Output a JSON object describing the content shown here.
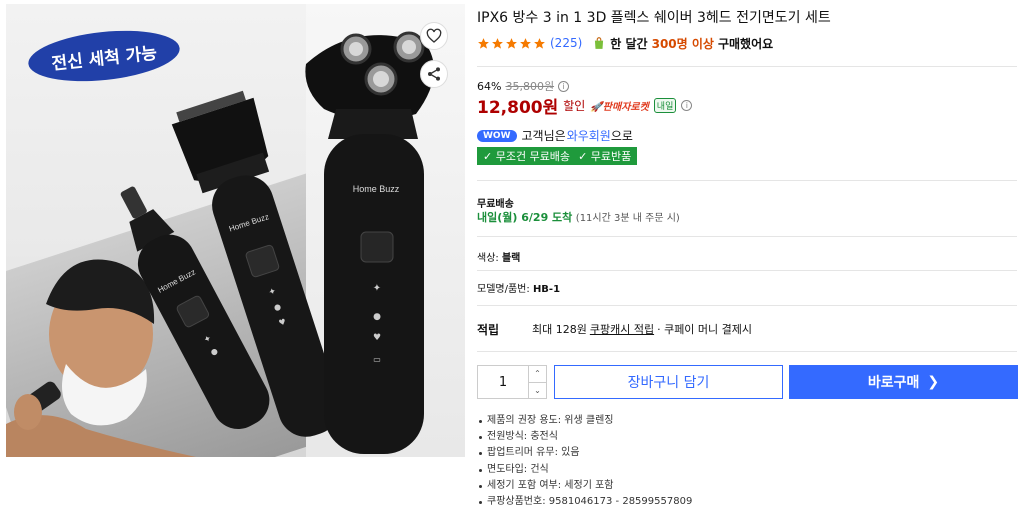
{
  "gallery": {
    "badge": "전신 세척 가능",
    "brand_text": "Home Buzz",
    "icons": {
      "wishlist": "heart-icon",
      "share": "share-icon"
    }
  },
  "product": {
    "title": "IPX6 방수 3 in 1 3D 플렉스 쉐이버 3헤드 전기면도기 세트",
    "rating": {
      "stars": 5,
      "review_count": "(225)"
    },
    "buyer_note": {
      "prefix": "한 달간",
      "highlight": "300명 이상",
      "suffix": "구매했어요"
    }
  },
  "price": {
    "discount_rate": "64%",
    "original": "35,800원",
    "sale": "12,800원",
    "sale_label": "할인",
    "rocket_label": "판매자로켓",
    "tomorrow_tag": "내일"
  },
  "wow": {
    "pill": "WOW",
    "text_before": "고객님은",
    "member": "와우회원",
    "text_after": "으로",
    "benefits": [
      "✓ 무조건 무료배송",
      "✓ 무료반품"
    ]
  },
  "shipping": {
    "label": "무료배송",
    "date": "내일(월) 6/29 도착",
    "cutoff": "(11시간 3분 내 주문 시)"
  },
  "options": {
    "color_label": "색상:",
    "color_value": "블랙",
    "model_label": "모델명/품번:",
    "model_value": "HB-1"
  },
  "points": {
    "title": "적립",
    "text_before": "최대 128원",
    "link": "쿠팡캐시 적립",
    "text_after": "· 쿠페이 머니 결제시"
  },
  "purchase": {
    "quantity": "1",
    "cart_label": "장바구니 담기",
    "buy_label": "바로구매",
    "buy_arrow": "❯"
  },
  "details": [
    "제품의 권장 용도: 위생 클렌징",
    "전원방식: 충전식",
    "팝업트리머 유무: 있음",
    "면도타입: 건식",
    "세정기 포함 여부: 세정기 포함",
    "쿠팡상품번호: 9581046173 - 28599557809"
  ],
  "colors": {
    "accent": "#346aff",
    "price_red": "#ae0000",
    "green": "#1f9a3c",
    "star": "#f57a00",
    "badge_blue": "#2140a8"
  }
}
